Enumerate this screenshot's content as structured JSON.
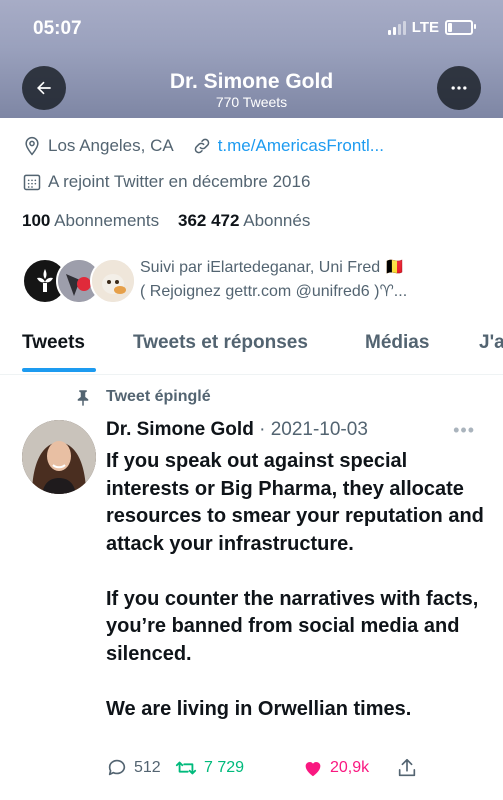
{
  "status_bar": {
    "time": "05:07",
    "network": "LTE"
  },
  "header": {
    "name": "Dr. Simone Gold",
    "tweet_count": "770 Tweets"
  },
  "profile": {
    "location": "Los Angeles, CA",
    "link": "t.me/AmericasFrontl...",
    "joined": "A rejoint Twitter en décembre 2016",
    "following_count": "100",
    "following_label": "Abonnements",
    "followers_count": "362 472",
    "followers_label": "Abonnés",
    "followed_by_line1": "Suivi par iElartedeganar, Uni Fred 🇧🇪",
    "followed_by_line2": "( Rejoignez gettr.com @unifred6 )♈..."
  },
  "tabs": [
    {
      "label": "Tweets"
    },
    {
      "label": "Tweets et réponses"
    },
    {
      "label": "Médias"
    },
    {
      "label": "J'a"
    }
  ],
  "tweet": {
    "pinned_label": "Tweet épinglé",
    "author": "Dr. Simone Gold",
    "date": "· 2021-10-03",
    "text": "If you speak out against special interests or Big Pharma, they allocate resources to smear your reputation and attack your infrastructure.\n\nIf you counter the narratives with facts, you’re banned from social media and silenced.\n\nWe are living in Orwellian times.",
    "replies": "512",
    "retweets": "7 729",
    "likes": "20,9k"
  },
  "colors": {
    "accent": "#1d9bf0",
    "retweet": "#00ba7c",
    "like": "#f91880",
    "muted": "#536471"
  }
}
